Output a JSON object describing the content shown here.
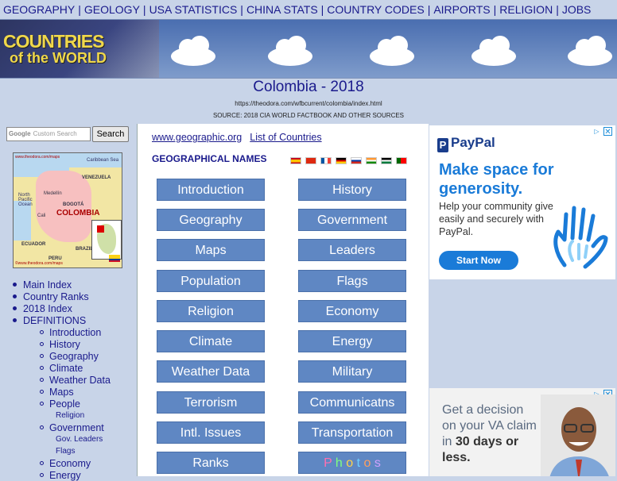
{
  "topnav": {
    "items": [
      "GEOGRAPHY",
      "GEOLOGY",
      "USA STATISTICS",
      "CHINA STATS",
      "COUNTRY CODES",
      "AIRPORTS",
      "RELIGION",
      "JOBS"
    ],
    "separator": "|"
  },
  "logo": {
    "line1": "COUNTRIES",
    "line2": "of the WORLD"
  },
  "page": {
    "title": "Colombia - 2018",
    "url": "https://theodora.com/wfbcurrent/colombia/index.html",
    "source": "SOURCE: 2018 CIA WORLD FACTBOOK AND OTHER SOURCES"
  },
  "search": {
    "placeholder": "Custom Search",
    "google_label": "Google",
    "button": "Search"
  },
  "map": {
    "watermark_top": "www.theodora.com/maps",
    "watermark_bottom": "©www.theodora.com/maps",
    "country": "COLOMBIA",
    "caribbean": "Caribbean Sea",
    "labels": {
      "venezuela": "VENEZUELA",
      "ecuador": "ECUADOR",
      "peru": "PERU",
      "brazil": "BRAZIL",
      "bogota": "BOGOTÁ",
      "medellin": "Medellín",
      "cali": "Cali",
      "pacific": "North Pacific Ocean"
    }
  },
  "left_menu": {
    "main": [
      "Main Index",
      "Country Ranks",
      "2018 Index",
      "DEFINITIONS"
    ],
    "definitions": [
      "Introduction",
      "History",
      "Geography",
      "Climate",
      "Weather Data",
      "Maps",
      "People"
    ],
    "people_sub": [
      "Religion"
    ],
    "government": "Government",
    "government_sub": [
      "Gov. Leaders",
      "Flags"
    ],
    "more": [
      "Economy",
      "Energy"
    ]
  },
  "center": {
    "link1": "www.geographic.org",
    "link2": "List of Countries",
    "geo_names": "GEOGRAPHICAL NAMES",
    "buttons_left": [
      "Introduction",
      "Geography",
      "Maps",
      "Population",
      "Religion",
      "Climate",
      "Weather Data",
      "Terrorism",
      "Intl. Issues",
      "Ranks"
    ],
    "buttons_right": [
      "History",
      "Government",
      "Leaders",
      "Flags",
      "Economy",
      "Energy",
      "Military",
      "Communicatns",
      "Transportation"
    ],
    "photos_letters": [
      "P",
      "h",
      "o",
      "t",
      "o",
      "s"
    ],
    "photos_colors": [
      "#ff6fb0",
      "#7fff7f",
      "#ffd24a",
      "#6fd0ff",
      "#ff9f5f",
      "#d0a0ff"
    ]
  },
  "ads": {
    "paypal": {
      "logo": "PayPal",
      "headline": "Make space for generosity.",
      "body": "Help your community give easily and securely with PayPal.",
      "button": "Start Now"
    },
    "va": {
      "line1": "Get a decision on your VA claim in",
      "bold": "30 days or less."
    },
    "close": "✕",
    "info": "▷"
  },
  "colors": {
    "link": "#1a1a8c",
    "button_bg": "#5f87c3",
    "page_bg": "#c8d4e8",
    "paypal_blue": "#1a7bd8"
  }
}
